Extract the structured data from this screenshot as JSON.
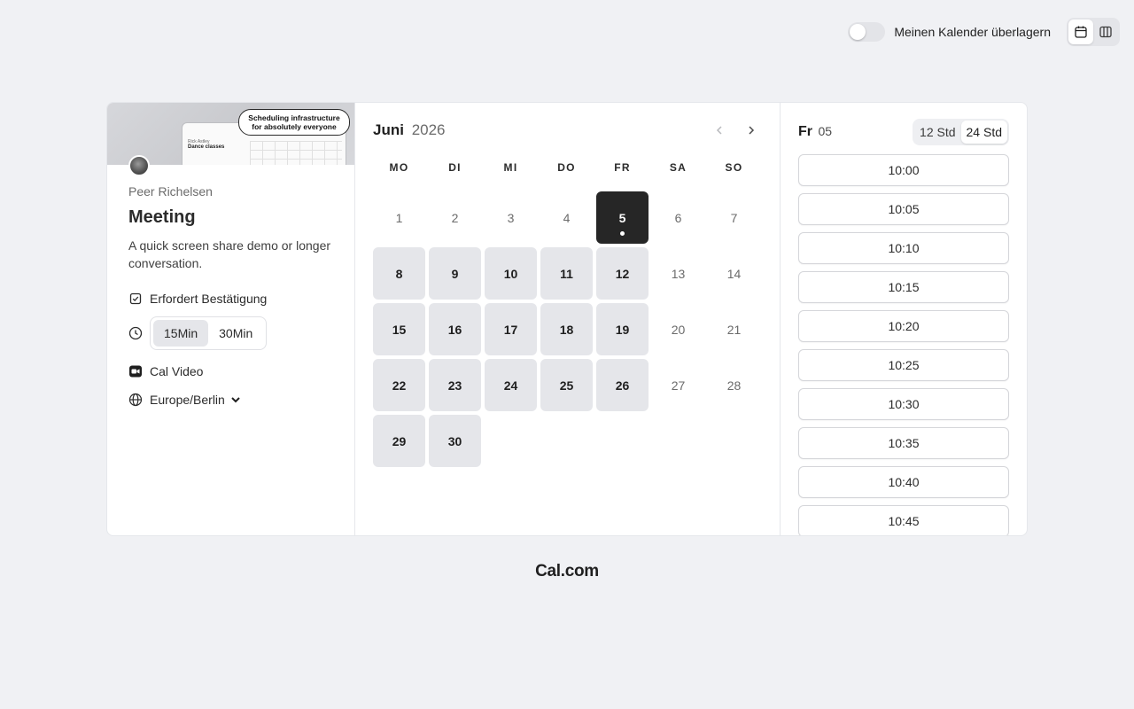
{
  "topbar": {
    "overlay_label": "Meinen Kalender überlagern",
    "overlay_enabled": false,
    "views": [
      {
        "icon": "calendar-icon",
        "active": true
      },
      {
        "icon": "columns-icon",
        "active": false
      }
    ]
  },
  "event": {
    "banner": {
      "headline_line1": "Scheduling infrastructure",
      "headline_line2": "for absolutely everyone",
      "mock_small": "Rick Astley",
      "mock_title": "Dance classes"
    },
    "host": "Peer Richelsen",
    "title": "Meeting",
    "description": "A quick screen share demo or longer conversation.",
    "requires_confirmation": "Erfordert Bestätigung",
    "durations": [
      {
        "label": "15Min",
        "active": true
      },
      {
        "label": "30Min",
        "active": false
      }
    ],
    "location": "Cal Video",
    "timezone": "Europe/Berlin"
  },
  "calendar": {
    "month": "Juni",
    "year": "2026",
    "weekdays": [
      "MO",
      "DI",
      "MI",
      "DO",
      "FR",
      "SA",
      "SO"
    ],
    "days": [
      {
        "d": "1",
        "s": "unavail"
      },
      {
        "d": "2",
        "s": "unavail"
      },
      {
        "d": "3",
        "s": "unavail"
      },
      {
        "d": "4",
        "s": "unavail"
      },
      {
        "d": "5",
        "s": "selected",
        "today": true
      },
      {
        "d": "6",
        "s": "unavail"
      },
      {
        "d": "7",
        "s": "unavail"
      },
      {
        "d": "8",
        "s": "avail"
      },
      {
        "d": "9",
        "s": "avail"
      },
      {
        "d": "10",
        "s": "avail"
      },
      {
        "d": "11",
        "s": "avail"
      },
      {
        "d": "12",
        "s": "avail"
      },
      {
        "d": "13",
        "s": "unavail"
      },
      {
        "d": "14",
        "s": "unavail"
      },
      {
        "d": "15",
        "s": "avail"
      },
      {
        "d": "16",
        "s": "avail"
      },
      {
        "d": "17",
        "s": "avail"
      },
      {
        "d": "18",
        "s": "avail"
      },
      {
        "d": "19",
        "s": "avail"
      },
      {
        "d": "20",
        "s": "unavail"
      },
      {
        "d": "21",
        "s": "unavail"
      },
      {
        "d": "22",
        "s": "avail"
      },
      {
        "d": "23",
        "s": "avail"
      },
      {
        "d": "24",
        "s": "avail"
      },
      {
        "d": "25",
        "s": "avail"
      },
      {
        "d": "26",
        "s": "avail"
      },
      {
        "d": "27",
        "s": "unavail"
      },
      {
        "d": "28",
        "s": "unavail"
      },
      {
        "d": "29",
        "s": "avail"
      },
      {
        "d": "30",
        "s": "avail"
      }
    ]
  },
  "slots": {
    "weekday": "Fr",
    "day": "05",
    "formats": [
      {
        "label": "12 Std",
        "active": false
      },
      {
        "label": "24 Std",
        "active": true
      }
    ],
    "times": [
      "10:00",
      "10:05",
      "10:10",
      "10:15",
      "10:20",
      "10:25",
      "10:30",
      "10:35",
      "10:40",
      "10:45"
    ]
  },
  "footer": {
    "brand": "Cal.com"
  },
  "colors": {
    "background": "#f0f1f4",
    "selected_day": "#262626",
    "available_day": "#e5e6ea"
  }
}
